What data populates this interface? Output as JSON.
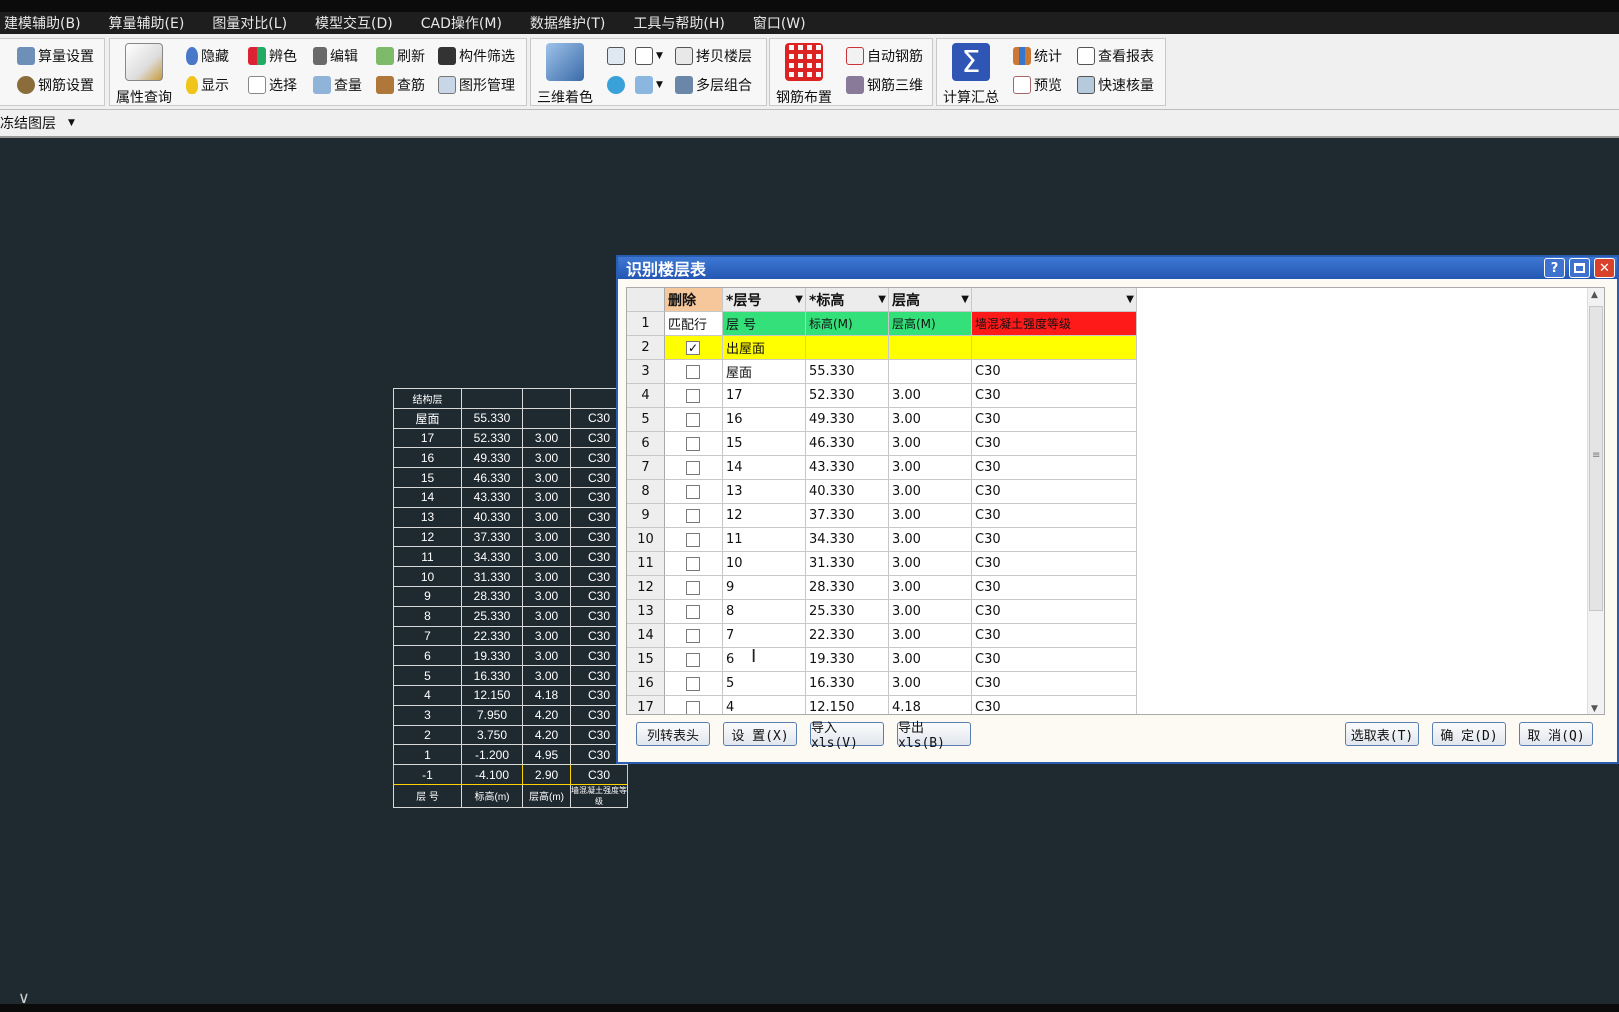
{
  "menu": [
    "建模辅助(B)",
    "算量辅助(E)",
    "图量对比(L)",
    "模型交互(D)",
    "CAD操作(M)",
    "数据维护(T)",
    "工具与帮助(H)",
    "窗口(W)"
  ],
  "ribbon": {
    "g1": {
      "a": "算量设置",
      "b": "钢筋设置"
    },
    "g2": {
      "big": "属性查询",
      "hide": "隐藏",
      "show": "显示",
      "color": "辨色",
      "select": "选择",
      "edit": "编辑",
      "check_qty": "查量",
      "refresh": "刷新",
      "check_rebar": "查筋",
      "filter": "构件筛选",
      "graph_mgmt": "图形管理"
    },
    "g3": {
      "big": "三维着色",
      "copy_floor": "拷贝楼层",
      "multi_floor": "多层组合"
    },
    "g4": {
      "big": "钢筋布置",
      "auto_rebar": "自动钢筋",
      "rebar_3d": "钢筋三维"
    },
    "g5": {
      "big": "计算汇总",
      "stats": "统计",
      "preview": "预览",
      "report": "查看报表",
      "quick_check": "快速核量"
    }
  },
  "layerbar": {
    "label": "冻结图层"
  },
  "cad_table": {
    "header": "结构层",
    "rows": [
      [
        "屋面",
        "55.330",
        "",
        "C30"
      ],
      [
        "17",
        "52.330",
        "3.00",
        "C30"
      ],
      [
        "16",
        "49.330",
        "3.00",
        "C30"
      ],
      [
        "15",
        "46.330",
        "3.00",
        "C30"
      ],
      [
        "14",
        "43.330",
        "3.00",
        "C30"
      ],
      [
        "13",
        "40.330",
        "3.00",
        "C30"
      ],
      [
        "12",
        "37.330",
        "3.00",
        "C30"
      ],
      [
        "11",
        "34.330",
        "3.00",
        "C30"
      ],
      [
        "10",
        "31.330",
        "3.00",
        "C30"
      ],
      [
        "9",
        "28.330",
        "3.00",
        "C30"
      ],
      [
        "8",
        "25.330",
        "3.00",
        "C30"
      ],
      [
        "7",
        "22.330",
        "3.00",
        "C30"
      ],
      [
        "6",
        "19.330",
        "3.00",
        "C30"
      ],
      [
        "5",
        "16.330",
        "3.00",
        "C30"
      ],
      [
        "4",
        "12.150",
        "4.18",
        "C30"
      ],
      [
        "3",
        "7.950",
        "4.20",
        "C30"
      ],
      [
        "2",
        "3.750",
        "4.20",
        "C30"
      ],
      [
        "1",
        "-1.200",
        "4.95",
        "C30"
      ],
      [
        "-1",
        "-4.100",
        "2.90",
        "C30"
      ]
    ],
    "footer": [
      "层 号",
      "标高(m)",
      "层高(m)",
      "墙混凝土强度等级"
    ]
  },
  "dialog": {
    "title": "识别楼层表",
    "help_glyph": "?",
    "columns": [
      "删除",
      "*层号",
      "*标高",
      "层高",
      ""
    ],
    "match_row": [
      "匹配行",
      "层 号",
      "标高(M)",
      "层高(M)",
      "墙混凝土强度等级"
    ],
    "rows": [
      {
        "n": "2",
        "checked": true,
        "floor": "出屋面",
        "elev": "",
        "height": "",
        "grade": ""
      },
      {
        "n": "3",
        "checked": false,
        "floor": "屋面",
        "elev": "55.330",
        "height": "",
        "grade": "C30"
      },
      {
        "n": "4",
        "checked": false,
        "floor": "17",
        "elev": "52.330",
        "height": "3.00",
        "grade": "C30"
      },
      {
        "n": "5",
        "checked": false,
        "floor": "16",
        "elev": "49.330",
        "height": "3.00",
        "grade": "C30"
      },
      {
        "n": "6",
        "checked": false,
        "floor": "15",
        "elev": "46.330",
        "height": "3.00",
        "grade": "C30"
      },
      {
        "n": "7",
        "checked": false,
        "floor": "14",
        "elev": "43.330",
        "height": "3.00",
        "grade": "C30"
      },
      {
        "n": "8",
        "checked": false,
        "floor": "13",
        "elev": "40.330",
        "height": "3.00",
        "grade": "C30"
      },
      {
        "n": "9",
        "checked": false,
        "floor": "12",
        "elev": "37.330",
        "height": "3.00",
        "grade": "C30"
      },
      {
        "n": "10",
        "checked": false,
        "floor": "11",
        "elev": "34.330",
        "height": "3.00",
        "grade": "C30"
      },
      {
        "n": "11",
        "checked": false,
        "floor": "10",
        "elev": "31.330",
        "height": "3.00",
        "grade": "C30"
      },
      {
        "n": "12",
        "checked": false,
        "floor": "9",
        "elev": "28.330",
        "height": "3.00",
        "grade": "C30"
      },
      {
        "n": "13",
        "checked": false,
        "floor": "8",
        "elev": "25.330",
        "height": "3.00",
        "grade": "C30"
      },
      {
        "n": "14",
        "checked": false,
        "floor": "7",
        "elev": "22.330",
        "height": "3.00",
        "grade": "C30"
      },
      {
        "n": "15",
        "checked": false,
        "floor": "6",
        "elev": "19.330",
        "height": "3.00",
        "grade": "C30"
      },
      {
        "n": "16",
        "checked": false,
        "floor": "5",
        "elev": "16.330",
        "height": "3.00",
        "grade": "C30"
      },
      {
        "n": "17",
        "checked": false,
        "floor": "4",
        "elev": "12.150",
        "height": "4.18",
        "grade": "C30"
      }
    ],
    "buttons": {
      "col_to_header": "列转表头",
      "settings": "设 置(X)",
      "import_xls": "导入xls(V)",
      "export_xls": "导出xls(B)",
      "select_table": "选取表(T)",
      "ok": "确 定(D)",
      "cancel": "取 消(Q)"
    }
  },
  "colors": {
    "match_row_green": "#33e07a",
    "match_row_red": "#ff1a1a",
    "row2_yellow": "#ffff00",
    "header_orange": "#f6c79a",
    "cad_bg": "#1f2930",
    "dialog_border": "#2a5db0"
  }
}
